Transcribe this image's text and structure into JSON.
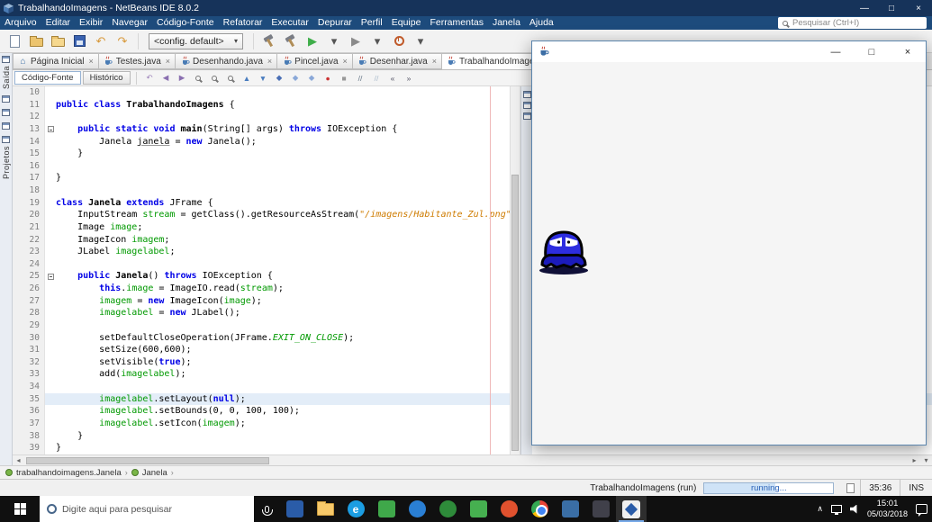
{
  "titlebar": {
    "title": "TrabalhandoImagens - NetBeans IDE 8.0.2",
    "minimize": "—",
    "maximize": "□",
    "close": "×"
  },
  "menubar": {
    "items": [
      "Arquivo",
      "Editar",
      "Exibir",
      "Navegar",
      "Código-Fonte",
      "Refatorar",
      "Executar",
      "Depurar",
      "Perfil",
      "Equipe",
      "Ferramentas",
      "Janela",
      "Ajuda"
    ],
    "search_placeholder": "Pesquisar (Ctrl+I)"
  },
  "toolbar": {
    "config_value": "<config. default>",
    "dropdown_glyph": "▾",
    "left_icons": [
      {
        "name": "new-file-icon",
        "shape": "page"
      },
      {
        "name": "new-project-icon",
        "shape": "folder"
      },
      {
        "name": "open-project-icon",
        "shape": "folder-open"
      },
      {
        "name": "save-all-icon",
        "shape": "disk"
      },
      {
        "name": "undo-icon",
        "glyph": "↶",
        "color": "#d89a3d"
      },
      {
        "name": "redo-icon",
        "glyph": "↷",
        "color": "#d89a3d"
      }
    ],
    "right_icons": [
      {
        "name": "build-project-icon",
        "shape": "hammer"
      },
      {
        "name": "clean-build-project-icon",
        "shape": "hammer"
      },
      {
        "name": "run-project-icon",
        "glyph": "▶",
        "color": "#3fae4a"
      },
      {
        "name": "run-dropdown-icon",
        "glyph": "▾",
        "color": "#555"
      },
      {
        "name": "debug-project-icon",
        "glyph": "▶",
        "color": "#8a8a8a"
      },
      {
        "name": "debug-dropdown-icon",
        "glyph": "▾",
        "color": "#555"
      },
      {
        "name": "profile-project-icon",
        "shape": "profile"
      },
      {
        "name": "profile-dropdown-icon",
        "glyph": "▾",
        "color": "#555"
      }
    ]
  },
  "left_strip": {
    "top_label": "Saída",
    "bottom_label": "Projetos"
  },
  "tabs": [
    {
      "label": "Página Inicial",
      "icon": "home",
      "active": false
    },
    {
      "label": "Testes.java",
      "icon": "java",
      "active": false
    },
    {
      "label": "Desenhando.java",
      "icon": "java",
      "active": false
    },
    {
      "label": "Pincel.java",
      "icon": "java",
      "active": false
    },
    {
      "label": "Desenhar.java",
      "icon": "java",
      "active": false
    },
    {
      "label": "TrabalhandoImagens.java",
      "icon": "java",
      "active": true
    }
  ],
  "tab_close_glyph": "×",
  "editor_toolbar": {
    "source_button": "Código-Fonte",
    "history_button": "Histórico",
    "icons": [
      {
        "name": "last-edit-icon",
        "glyph": "↶",
        "color": "#9a7fb8"
      },
      {
        "name": "back-icon",
        "glyph": "◀",
        "color": "#8a6fb0"
      },
      {
        "name": "forward-icon",
        "glyph": "▶",
        "color": "#8a6fb0"
      },
      {
        "name": "find-icon",
        "glyph": "mag"
      },
      {
        "name": "find-selection-icon",
        "glyph": "mag"
      },
      {
        "name": "toggle-search-highlight-icon",
        "glyph": "mag"
      },
      {
        "name": "previous-occurrence-icon",
        "glyph": "▲",
        "color": "#4a7dbf"
      },
      {
        "name": "next-occurrence-icon",
        "glyph": "▼",
        "color": "#4a7dbf"
      },
      {
        "name": "toggle-bookmark-icon",
        "glyph": "◆",
        "color": "#4a6fb5"
      },
      {
        "name": "previous-bookmark-icon",
        "glyph": "◆",
        "color": "#8aa8d8"
      },
      {
        "name": "next-bookmark-icon",
        "glyph": "◆",
        "color": "#8aa8d8"
      },
      {
        "name": "record-macro-icon",
        "glyph": "●",
        "color": "#cc3333"
      },
      {
        "name": "stop-macro-icon",
        "glyph": "■",
        "color": "#999999"
      },
      {
        "name": "comment-icon",
        "glyph": "//",
        "color": "#667788"
      },
      {
        "name": "uncomment-icon",
        "glyph": "//",
        "color": "#aabbcc"
      },
      {
        "name": "shift-left-icon",
        "glyph": "«",
        "color": "#556"
      },
      {
        "name": "shift-right-icon",
        "glyph": "»",
        "color": "#556"
      }
    ]
  },
  "code": {
    "lines": [
      {
        "n": 10,
        "s": []
      },
      {
        "n": 11,
        "s": [
          [
            "k",
            "public class "
          ],
          [
            "b",
            "TrabalhandoImagens"
          ],
          [
            "p",
            " {"
          ]
        ]
      },
      {
        "n": 12,
        "s": []
      },
      {
        "n": 13,
        "f": true,
        "s": [
          [
            "p",
            "    "
          ],
          [
            "k",
            "public static void "
          ],
          [
            "b",
            "main"
          ],
          [
            "p",
            "(String[] args) "
          ],
          [
            "k",
            "throws"
          ],
          [
            "p",
            " IOException {"
          ]
        ]
      },
      {
        "n": 14,
        "s": [
          [
            "p",
            "        Janela "
          ],
          [
            "u",
            "janela"
          ],
          [
            "p",
            " = "
          ],
          [
            "k",
            "new"
          ],
          [
            "p",
            " Janela();"
          ]
        ]
      },
      {
        "n": 15,
        "s": [
          [
            "p",
            "    }"
          ]
        ]
      },
      {
        "n": 16,
        "s": []
      },
      {
        "n": 17,
        "s": [
          [
            "p",
            "}"
          ]
        ]
      },
      {
        "n": 18,
        "s": []
      },
      {
        "n": 19,
        "s": [
          [
            "k",
            "class "
          ],
          [
            "b",
            "Janela"
          ],
          [
            "p",
            " "
          ],
          [
            "k",
            "extends"
          ],
          [
            "p",
            " JFrame {"
          ]
        ]
      },
      {
        "n": 20,
        "s": [
          [
            "p",
            "    InputStream "
          ],
          [
            "g",
            "stream"
          ],
          [
            "p",
            " = getClass().getResourceAsStream("
          ],
          [
            "s",
            "\"/imagens/Habitante_Zul.png\""
          ],
          [
            "p",
            ");"
          ]
        ]
      },
      {
        "n": 21,
        "s": [
          [
            "p",
            "    Image "
          ],
          [
            "g",
            "image"
          ],
          [
            "p",
            ";"
          ]
        ]
      },
      {
        "n": 22,
        "s": [
          [
            "p",
            "    ImageIcon "
          ],
          [
            "g",
            "imagem"
          ],
          [
            "p",
            ";"
          ]
        ]
      },
      {
        "n": 23,
        "s": [
          [
            "p",
            "    JLabel "
          ],
          [
            "g",
            "imagelabel"
          ],
          [
            "p",
            ";"
          ]
        ]
      },
      {
        "n": 24,
        "s": []
      },
      {
        "n": 25,
        "f": true,
        "s": [
          [
            "p",
            "    "
          ],
          [
            "k",
            "public "
          ],
          [
            "b",
            "Janela"
          ],
          [
            "p",
            "() "
          ],
          [
            "k",
            "throws"
          ],
          [
            "p",
            " IOException {"
          ]
        ]
      },
      {
        "n": 26,
        "s": [
          [
            "p",
            "        "
          ],
          [
            "k",
            "this"
          ],
          [
            "p",
            "."
          ],
          [
            "g",
            "image"
          ],
          [
            "p",
            " = ImageIO.read("
          ],
          [
            "g",
            "stream"
          ],
          [
            "p",
            ");"
          ]
        ]
      },
      {
        "n": 27,
        "s": [
          [
            "p",
            "        "
          ],
          [
            "g",
            "imagem"
          ],
          [
            "p",
            " = "
          ],
          [
            "k",
            "new"
          ],
          [
            "p",
            " ImageIcon("
          ],
          [
            "g",
            "image"
          ],
          [
            "p",
            ");"
          ]
        ]
      },
      {
        "n": 28,
        "s": [
          [
            "p",
            "        "
          ],
          [
            "g",
            "imagelabel"
          ],
          [
            "p",
            " = "
          ],
          [
            "k",
            "new"
          ],
          [
            "p",
            " JLabel();"
          ]
        ]
      },
      {
        "n": 29,
        "s": []
      },
      {
        "n": 30,
        "s": [
          [
            "p",
            "        setDefaultCloseOperation(JFrame."
          ],
          [
            "gi",
            "EXIT_ON_CLOSE"
          ],
          [
            "p",
            ");"
          ]
        ]
      },
      {
        "n": 31,
        "s": [
          [
            "p",
            "        setSize(600,600);"
          ]
        ]
      },
      {
        "n": 32,
        "s": [
          [
            "p",
            "        setVisible("
          ],
          [
            "k",
            "true"
          ],
          [
            "p",
            ");"
          ]
        ]
      },
      {
        "n": 33,
        "s": [
          [
            "p",
            "        add("
          ],
          [
            "g",
            "imagelabel"
          ],
          [
            "p",
            ");"
          ]
        ]
      },
      {
        "n": 34,
        "s": []
      },
      {
        "n": 35,
        "hl": true,
        "s": [
          [
            "p",
            "        "
          ],
          [
            "g",
            "imagelabel"
          ],
          [
            "p",
            ".setLayout("
          ],
          [
            "k",
            "null"
          ],
          [
            "p",
            ");"
          ]
        ]
      },
      {
        "n": 36,
        "s": [
          [
            "p",
            "        "
          ],
          [
            "g",
            "imagelabel"
          ],
          [
            "p",
            ".setBounds(0, 0, 100, 100);"
          ]
        ]
      },
      {
        "n": 37,
        "s": [
          [
            "p",
            "        "
          ],
          [
            "g",
            "imagelabel"
          ],
          [
            "p",
            ".setIcon("
          ],
          [
            "g",
            "imagem"
          ],
          [
            "p",
            ");"
          ]
        ]
      },
      {
        "n": 38,
        "s": [
          [
            "p",
            "    }"
          ]
        ]
      },
      {
        "n": 39,
        "s": [
          [
            "p",
            "}"
          ]
        ]
      }
    ]
  },
  "breadcrumb": {
    "separator": "›",
    "items": [
      {
        "label": "trabalhandoimagens.Janela"
      },
      {
        "label": "Janela"
      }
    ]
  },
  "statusbar": {
    "run_task": "TrabalhandoImagens (run)",
    "progress_text": "running...",
    "progress_pct": 55,
    "caret": "35:36",
    "insert_mode": "INS"
  },
  "floating_window": {
    "minimize": "—",
    "maximize": "□",
    "close": "×"
  },
  "taskbar": {
    "search_placeholder": "Digite aqui para pesquisar",
    "apps": [
      {
        "id": "app1",
        "shape": "square",
        "color": "#2a5ca8"
      },
      {
        "id": "file-explorer",
        "shape": "folder"
      },
      {
        "id": "edge",
        "shape": "circle",
        "color": "#1b9de2",
        "label": "e"
      },
      {
        "id": "app2",
        "shape": "square",
        "color": "#3fa84a"
      },
      {
        "id": "app3",
        "shape": "circle",
        "color": "#2a7fd4"
      },
      {
        "id": "app4",
        "shape": "circle",
        "color": "#2e8b3a"
      },
      {
        "id": "app5",
        "shape": "square",
        "color": "#46b050"
      },
      {
        "id": "firefox",
        "shape": "circle",
        "color": "#e0512e"
      },
      {
        "id": "chrome",
        "shape": "chrome"
      },
      {
        "id": "app6",
        "shape": "square",
        "color": "#3a6ea5"
      },
      {
        "id": "app7",
        "shape": "square",
        "color": "#40404a"
      },
      {
        "id": "netbeans",
        "shape": "netbeans",
        "active": true
      }
    ],
    "tray": {
      "time": "15:01",
      "date": "05/03/2018"
    }
  }
}
